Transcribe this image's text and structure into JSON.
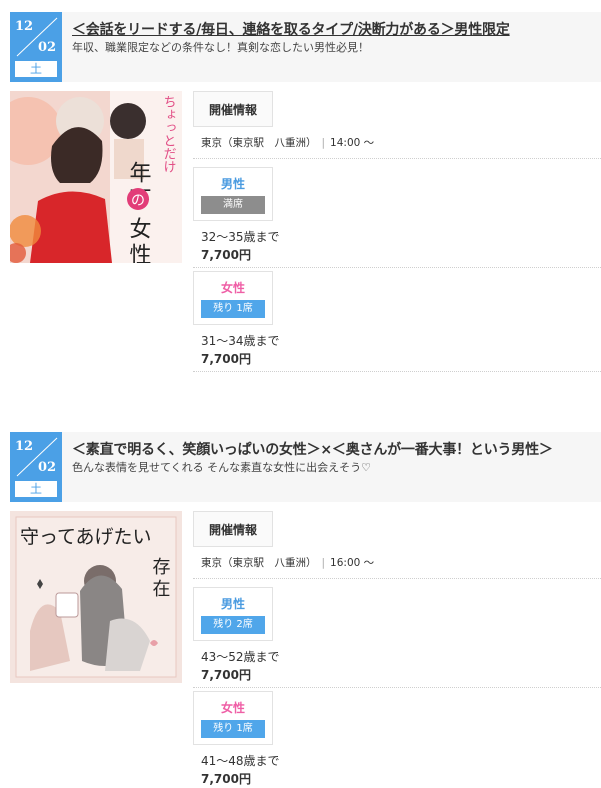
{
  "events": [
    {
      "date": {
        "month": "12",
        "day": "02",
        "weekday": "土"
      },
      "title_link": "＜会話をリードする/毎日、連絡を取るタイプ/決断力がある＞男性限定",
      "subtitle": "年収、職業限定などの条件なし！真剣な恋したい男性必見！",
      "image_caption_vertical": "ちょっとだけ",
      "image_caption_main": "年下の女性",
      "info_label": "開催情報",
      "place": "東京（東京駅　八重洲）",
      "time": "14:00 ～",
      "male": {
        "label": "男性",
        "status": "満席",
        "age": "32～35歳まで",
        "price": "7,700円"
      },
      "female": {
        "label": "女性",
        "status": "残り 1席",
        "age": "31～34歳まで",
        "price": "7,700円"
      }
    },
    {
      "date": {
        "month": "12",
        "day": "02",
        "weekday": "土"
      },
      "title_link": "＜素直で明るく、笑顔いっぱいの女性＞×＜奥さんが一番大事！という男性＞",
      "subtitle": "色んな表情を見せてくれる そんな素直な女性に出会えそう♡",
      "image_caption_top": "守ってあげたい",
      "image_caption_main": "存在",
      "info_label": "開催情報",
      "place": "東京（東京駅　八重洲）",
      "time": "16:00 ～",
      "male": {
        "label": "男性",
        "status": "残り 2席",
        "age": "43～52歳まで",
        "price": "7,700円"
      },
      "female": {
        "label": "女性",
        "status": "残り 1席",
        "age": "41～48歳まで",
        "price": "7,700円"
      }
    }
  ],
  "colors": {
    "date_blue": "#4ba0e6",
    "male": "#4a9be0",
    "female": "#ef5fa6",
    "full": "#8d8d8d",
    "avail": "#50a6ea"
  }
}
